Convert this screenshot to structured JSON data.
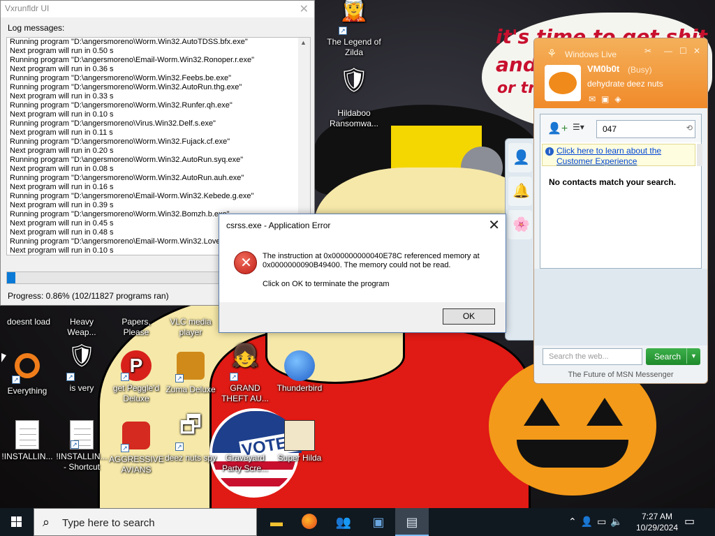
{
  "desktop": {
    "wallpaper_text": [
      "it's time to get shit",
      "and",
      "or tr"
    ],
    "stamp_text": "VOTED",
    "icons": [
      {
        "label": "The Legend of Zilda",
        "glyph": "🧝"
      },
      {
        "label": "Hildaboo Ransomwa...",
        "glyph": "🛡"
      },
      {
        "label": "doesnt load",
        "glyph": "🔵"
      },
      {
        "label": "Heavy Weap...",
        "glyph": "🔫"
      },
      {
        "label": "Papers, Please",
        "glyph": "📄"
      },
      {
        "label": "VLC media player",
        "glyph": "🔶"
      },
      {
        "label": "Everything",
        "glyph": "🔍"
      },
      {
        "label": "is very",
        "glyph": "🛡"
      },
      {
        "label": "get Peggle'd Deluxe",
        "glyph": "🅿"
      },
      {
        "label": "Zuma Deluxe",
        "glyph": "🐸"
      },
      {
        "label": "GRAND THEFT AU...",
        "glyph": "👧"
      },
      {
        "label": "Thunderbird",
        "glyph": "🐦"
      },
      {
        "label": "!INSTALLIN...",
        "glyph": ""
      },
      {
        "label": "!INSTALLIN... - Shortcut",
        "glyph": ""
      },
      {
        "label": "AGGRESSIVE AVIANS",
        "glyph": "🐦"
      },
      {
        "label": "deez nuts spy",
        "glyph": "🗗"
      },
      {
        "label": "Graveyard Party Scre...",
        "glyph": "🎃"
      },
      {
        "label": "Super Hilda",
        "glyph": "🐶"
      }
    ]
  },
  "vx": {
    "title": "Vxrunfldr UI",
    "log_label": "Log messages:",
    "log": [
      "Running program \"D:\\angersmoreno\\Worm.Win32.AutoTDSS.bfx.exe\"",
      "Next program will run in 0.50 s",
      "Running program \"D:\\angersmoreno\\Email-Worm.Win32.Ronoper.r.exe\"",
      "Next program will run in 0.36 s",
      "Running program \"D:\\angersmoreno\\Worm.Win32.Feebs.be.exe\"",
      "Running program \"D:\\angersmoreno\\Worm.Win32.AutoRun.thg.exe\"",
      "Next program will run in 0.33 s",
      "Running program \"D:\\angersmoreno\\Worm.Win32.Runfer.qh.exe\"",
      "Next program will run in 0.10 s",
      "Running program \"D:\\angersmoreno\\Virus.Win32.Delf.s.exe\"",
      "Next program will run in 0.11 s",
      "Running program \"D:\\angersmoreno\\Worm.Win32.Fujack.cf.exe\"",
      "Next program will run in 0.20 s",
      "Running program \"D:\\angersmoreno\\Worm.Win32.AutoRun.syq.exe\"",
      "Next program will run in 0.08 s",
      "Running program \"D:\\angersmoreno\\Worm.Win32.AutoRun.auh.exe\"",
      "Next program will run in 0.16 s",
      "Running program \"D:\\angersmoreno\\Email-Worm.Win32.Kebede.g.exe\"",
      "Next program will run in 0.39 s",
      "Running program \"D:\\angersmoreno\\Worm.Win32.Bomzh.b.exe\"",
      "Next program will run in 0.45 s",
      "Next program will run in 0.48 s",
      "Running program \"D:\\angersmoreno\\Email-Worm.Win32.LoveL",
      "Next program will run in 0.10 s"
    ],
    "progress_fraction": 0.0086,
    "progress_text": "Progress: 0.86% (102/11827 programs ran)"
  },
  "error_dialog": {
    "title": "csrss.exe - Application Error",
    "message": "The instruction at 0x000000000040E78C referenced memory at 0x0000000090B49400. The memory could not be read.",
    "instruction": "Click on OK to terminate the program",
    "ok_label": "OK"
  },
  "msn": {
    "brand": "Windows Live",
    "username": "VM0b0t",
    "status": "(Busy)",
    "personal_message": "dehydrate deez nuts",
    "contact_search_value": "047",
    "info_link": "Click here to learn about the Customer Experience",
    "no_match": "No contacts match your search.",
    "web_search_placeholder": "Search the web...",
    "search_button": "Search",
    "footer": "The Future of MSN Messenger",
    "accent": "#f08a2a"
  },
  "taskbar": {
    "search_placeholder": "Type here to search",
    "apps": [
      "file-explorer",
      "firefox",
      "messenger",
      "vxrunfldr",
      "active-window"
    ],
    "time": "7:27 AM",
    "date": "10/29/2024"
  }
}
